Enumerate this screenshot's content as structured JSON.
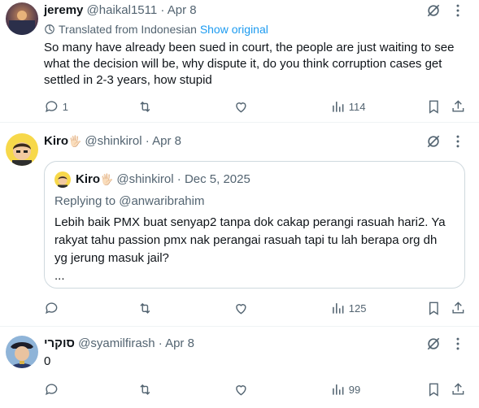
{
  "tweets": [
    {
      "name": "jeremy",
      "handle": "@haikal1511",
      "date": "· Apr 8",
      "translated_label": "Translated from Indonesian",
      "show_original": "Show original",
      "text": "So many have already been sued in court, the people are just waiting to see what the decision will be, why dispute it, do you think corruption cases get settled in 2-3 years, how stupid",
      "replies": "1",
      "reposts": "",
      "likes": "",
      "views": "114"
    },
    {
      "name": "Kiro",
      "name_emoji": "🖐🏻",
      "handle": "@shinkirol",
      "date": "· Apr 8",
      "replies": "",
      "reposts": "",
      "likes": "",
      "views": "125",
      "quote": {
        "name": "Kiro",
        "name_emoji": "🖐🏻",
        "handle": "@shinkirol",
        "date": "· Dec 5, 2025",
        "replying_to": "Replying to @anwaribrahim",
        "text_lines": [
          "Lebih baik PMX buat senyap2 tanpa dok cakap perangi rasuah hari2. Ya",
          "rakyat tahu passion pmx nak perangai rasuah tapi tu lah berapa org dh",
          "yg jerung masuk jail?",
          "..."
        ]
      }
    },
    {
      "name": "סוקרי",
      "handle": "@syamilfirash",
      "date": "· Apr 8",
      "text": "0",
      "replies": "",
      "reposts": "",
      "likes": "",
      "views": "99"
    }
  ],
  "icons": {
    "grok": "grok-slash-icon",
    "more": "more-vertical-dots-icon",
    "reply": "reply-bubble-icon",
    "repost": "repost-arrows-icon",
    "like": "heart-icon",
    "views": "views-bars-icon",
    "bookmark": "bookmark-icon",
    "share": "share-upload-icon",
    "translate": "translate-globe-icon"
  },
  "colors": {
    "text": "#0f1419",
    "secondary": "#536471",
    "link": "#1d9bf0",
    "border": "#cfd9de",
    "divider": "#eff3f4"
  }
}
